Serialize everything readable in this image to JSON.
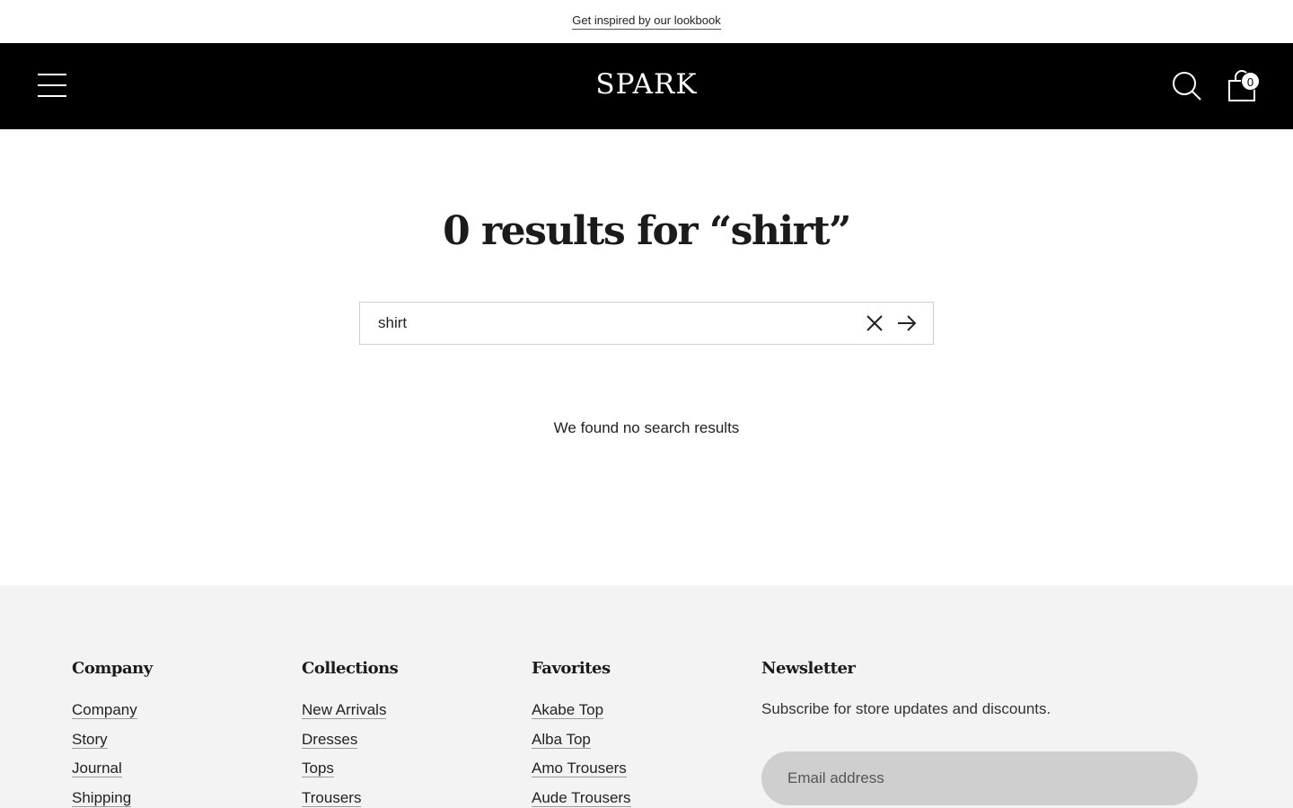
{
  "announcement": {
    "link_text": "Get inspired by our lookbook"
  },
  "header": {
    "logo": "SPARK",
    "cart_count": "0",
    "icons": {
      "menu": "hamburger-menu-icon",
      "search": "search-icon",
      "cart": "shopping-bag-icon"
    }
  },
  "search": {
    "results_title": "0 results for “shirt”",
    "query": "shirt",
    "empty_message": "We found no search results",
    "icons": {
      "clear": "close-icon",
      "submit": "arrow-right-icon"
    }
  },
  "footer": {
    "columns": [
      {
        "heading": "Company",
        "links": [
          "Company",
          "Story",
          "Journal",
          "Shipping"
        ]
      },
      {
        "heading": "Collections",
        "links": [
          "New Arrivals",
          "Dresses",
          "Tops",
          "Trousers"
        ]
      },
      {
        "heading": "Favorites",
        "links": [
          "Akabe Top",
          "Alba Top",
          "Amo Trousers",
          "Aude Trousers"
        ]
      }
    ],
    "newsletter": {
      "heading": "Newsletter",
      "text": "Subscribe for store updates and discounts.",
      "email_placeholder": "Email address"
    }
  },
  "colors": {
    "header_bg": "#000000",
    "footer_bg": "#f3f3f3",
    "input_bg": "#cfcfcf"
  }
}
